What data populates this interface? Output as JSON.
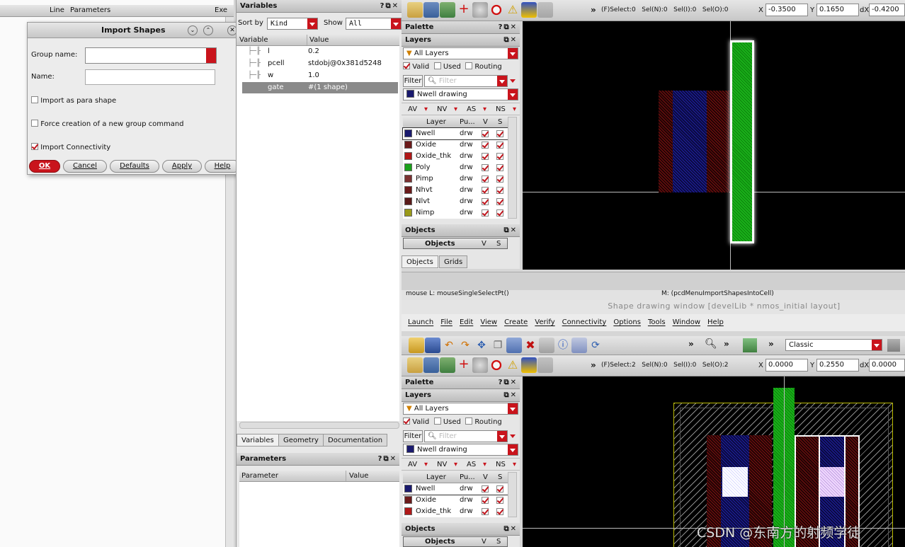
{
  "left_table": {
    "col_line": "Line",
    "col_params": "Parameters",
    "col_exe": "Exe"
  },
  "dialog": {
    "title": "Import Shapes",
    "group_name_label": "Group name:",
    "name_label": "Name:",
    "opt_para": "Import as para shape",
    "opt_force": "Force creation of a new group command",
    "opt_connectivity": "Import Connectivity",
    "btn_ok": "OK",
    "btn_cancel": "Cancel",
    "btn_defaults": "Defaults",
    "btn_apply": "Apply",
    "btn_help": "Help"
  },
  "variables": {
    "title": "Variables",
    "sort_label": "Sort by",
    "sort_value": "Kind",
    "show_label": "Show",
    "show_value": "All",
    "col_variable": "Variable",
    "col_value": "Value",
    "rows": [
      {
        "name": "l",
        "value": "0.2"
      },
      {
        "name": "pcell",
        "value": "stdobj@0x381d5248"
      },
      {
        "name": "w",
        "value": "1.0"
      },
      {
        "name": "gate",
        "value": "#(1 shape)"
      }
    ],
    "tabs": [
      "Variables",
      "Geometry",
      "Documentation"
    ]
  },
  "parameters": {
    "title": "Parameters",
    "col_parameter": "Parameter",
    "col_value": "Value"
  },
  "top": {
    "status": "(F)Select:0   Sel(N):0   Sel(I):0   Sel(O):0",
    "x_label": "X",
    "x_value": "-0.3500",
    "y_label": "Y",
    "y_value": "0.1650",
    "dx_label": "dX",
    "dx_value": "-0.4200",
    "more": "»"
  },
  "palette": {
    "title": "Palette",
    "layers_title": "Layers",
    "all_layers": "All Layers",
    "valid": "Valid",
    "used": "Used",
    "routing": "Routing",
    "filter_btn": "Filter",
    "filter_placeholder": "Filter",
    "current_layer": "Nwell drawing",
    "vis": [
      "AV",
      "NV",
      "AS",
      "NS"
    ],
    "col_layer": "Layer",
    "col_pu": "Pu...",
    "col_v": "V",
    "col_s": "S",
    "layers": [
      {
        "name": "Nwell",
        "p": "drw",
        "color": "#1a1a6e"
      },
      {
        "name": "Oxide",
        "p": "drw",
        "color": "#6b1a1a"
      },
      {
        "name": "Oxide_thk",
        "p": "drw",
        "color": "#b01818"
      },
      {
        "name": "Poly",
        "p": "drw",
        "color": "#1aa01a"
      },
      {
        "name": "Pimp",
        "p": "drw",
        "color": "#7a3030"
      },
      {
        "name": "Nhvt",
        "p": "drw",
        "color": "#6a1a1a"
      },
      {
        "name": "Nlvt",
        "p": "drw",
        "color": "#5a1a1a"
      },
      {
        "name": "Nimp",
        "p": "drw",
        "color": "#9a9a1a"
      }
    ],
    "objects_title": "Objects",
    "objects_col": "Objects",
    "tab_objects": "Objects",
    "tab_grids": "Grids"
  },
  "statusbar": {
    "mouse": "mouse L: mouseSingleSelectPt()",
    "middle": "M: (pcdMenuImportShapesIntoCell)"
  },
  "window2": {
    "title": "Shape drawing window [develLib * nmos_initial layout]",
    "menu": [
      "Launch",
      "File",
      "Edit",
      "View",
      "Create",
      "Verify",
      "Connectivity",
      "Options",
      "Tools",
      "Window",
      "Help"
    ],
    "workspace": "Classic",
    "status": "(F)Select:2   Sel(N):0   Sel(I):0   Sel(O):2",
    "x_value": "0.0000",
    "y_value": "0.2550",
    "dx_value": "0.0000"
  },
  "watermark": "CSDN @东南方的射频学徒"
}
